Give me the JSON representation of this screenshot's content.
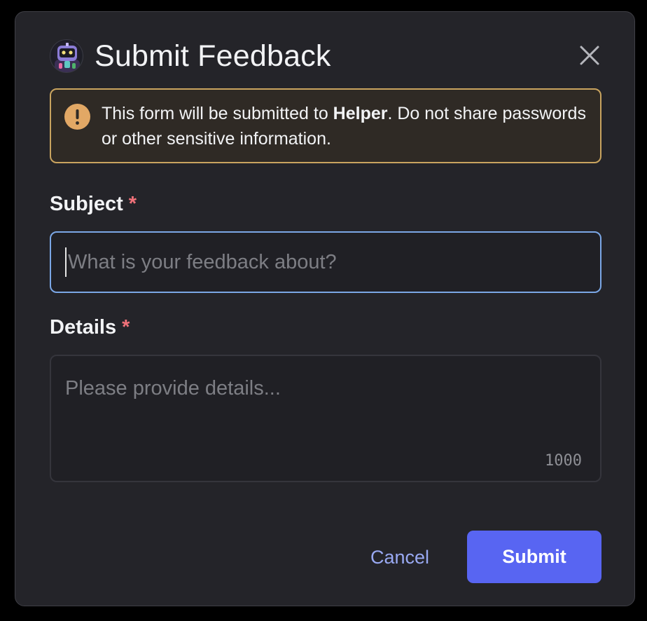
{
  "dialog": {
    "title": "Submit Feedback",
    "avatar_icon": "robot-avatar-icon",
    "close_icon": "close-icon"
  },
  "warning": {
    "icon": "exclamation-icon",
    "text_before": "This form will be submitted to ",
    "bold": "Helper",
    "text_after": ". Do not share passwords or other sensitive information."
  },
  "subject": {
    "label": "Subject",
    "required_mark": "*",
    "placeholder": "What is your feedback about?"
  },
  "details": {
    "label": "Details",
    "required_mark": "*",
    "placeholder": "Please provide details...",
    "char_counter": "1000"
  },
  "actions": {
    "cancel_label": "Cancel",
    "submit_label": "Submit"
  },
  "colors": {
    "accent": "#5865f2",
    "warning_border": "#c9a45f",
    "warning_icon": "#e2a865",
    "required": "#f2727a",
    "focus_border": "#7ba7e6",
    "link": "#99a9f2"
  }
}
